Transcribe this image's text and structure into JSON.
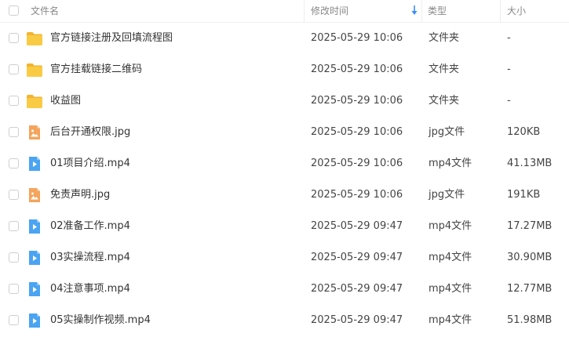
{
  "columns": {
    "name": "文件名",
    "modified": "修改时间",
    "type": "类型",
    "size": "大小"
  },
  "sort": {
    "column": "modified",
    "direction": "descending",
    "icon": "arrow-down-icon",
    "color": "#3b8cf5"
  },
  "icon_colors": {
    "folder": "#f7c23f",
    "image": "#f5a45b",
    "video": "#4aa4f2"
  },
  "files": [
    {
      "icon": "folder-icon",
      "name": "官方链接注册及回填流程图",
      "modified": "2025-05-29 10:06",
      "type": "文件夹",
      "size": "-"
    },
    {
      "icon": "folder-icon",
      "name": "官方挂载链接二维码",
      "modified": "2025-05-29 10:06",
      "type": "文件夹",
      "size": "-"
    },
    {
      "icon": "folder-icon",
      "name": "收益图",
      "modified": "2025-05-29 10:06",
      "type": "文件夹",
      "size": "-"
    },
    {
      "icon": "image-file-icon",
      "name": "后台开通权限.jpg",
      "modified": "2025-05-29 10:06",
      "type": "jpg文件",
      "size": "120KB"
    },
    {
      "icon": "video-file-icon",
      "name": "01项目介绍.mp4",
      "modified": "2025-05-29 10:06",
      "type": "mp4文件",
      "size": "41.13MB"
    },
    {
      "icon": "image-file-icon",
      "name": "免责声明.jpg",
      "modified": "2025-05-29 10:06",
      "type": "jpg文件",
      "size": "191KB"
    },
    {
      "icon": "video-file-icon",
      "name": "02准备工作.mp4",
      "modified": "2025-05-29 09:47",
      "type": "mp4文件",
      "size": "17.27MB"
    },
    {
      "icon": "video-file-icon",
      "name": "03实操流程.mp4",
      "modified": "2025-05-29 09:47",
      "type": "mp4文件",
      "size": "30.90MB"
    },
    {
      "icon": "video-file-icon",
      "name": "04注意事项.mp4",
      "modified": "2025-05-29 09:47",
      "type": "mp4文件",
      "size": "12.77MB"
    },
    {
      "icon": "video-file-icon",
      "name": "05实操制作视频.mp4",
      "modified": "2025-05-29 09:47",
      "type": "mp4文件",
      "size": "51.98MB"
    }
  ]
}
